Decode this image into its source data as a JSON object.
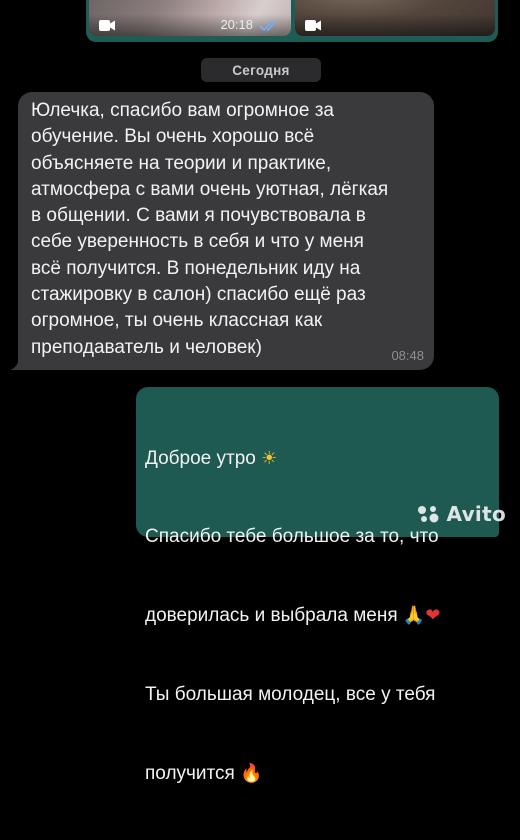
{
  "media_message": {
    "time": "20:18",
    "left_icon": "video-icon",
    "right_icon": "video-icon",
    "status_icon": "double-check-icon"
  },
  "date_separator": "Сегодня",
  "incoming_message": {
    "text": "Юлечка, спасибо вам огромное за\nобучение. Вы очень хорошо всё\nобъясняете на теории и практике,\nатмосфера с вами очень уютная, лёгкая\nв общении. С вами я почувствовала в\nсебе уверенность в себя и что у меня\nвсё получится. В понедельник иду на\nстажировку в салон) спасибо ещё раз\nогромное, ты очень классная как\nпреподаватель и человек)",
    "time": "08:48"
  },
  "outgoing_message": {
    "line1": "Доброе утро",
    "line2": "Спасибо тебе большое за то, что",
    "line3": "доверилась и выбрала меня",
    "line4": "Ты большая молодец, все у тебя",
    "line5": "получится",
    "emojis": {
      "sun": "☀",
      "pray": "🙏",
      "heart": "❤",
      "fire": "🔥"
    }
  },
  "watermark": {
    "text": "Avito",
    "logo": "avito-dots-logo"
  },
  "colors": {
    "background": "#000000",
    "incoming_bubble": "#3a3a3c",
    "outgoing_bubble": "#1e5952",
    "date_pill": "#2b2b2d",
    "read_ticks": "#6fb1ff"
  }
}
